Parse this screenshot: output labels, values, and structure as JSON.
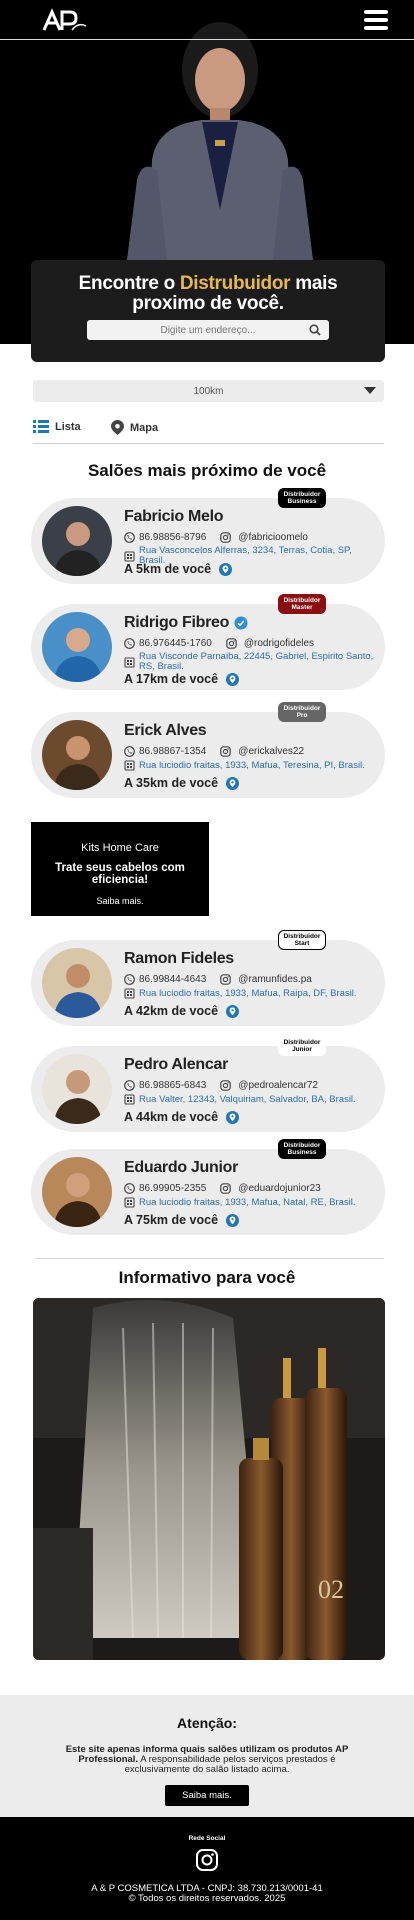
{
  "header": {
    "logo_alt": "AP",
    "menu_icon": "hamburger-icon"
  },
  "hero": {
    "title_pre": "Encontre o ",
    "title_highlight": "Distrubuidor",
    "title_post": " mais",
    "title_line2": "proximo de você.",
    "search_placeholder": "Digite um endereço..."
  },
  "filters": {
    "distance_value": "100km",
    "tab_list": "Lista",
    "tab_map": "Mapa"
  },
  "salons_section": {
    "title": "Salões mais próximo de você",
    "items": [
      {
        "name": "Fabricio Melo",
        "verified": false,
        "phone": "86.98856-8796",
        "instagram": "@fabricioomelo",
        "address": "Rua Vasconcelos Alferras, 3234, Terras, Cotia, SP, Brasil.",
        "distance": "A 5km de você",
        "badge_line1": "Distribuidor",
        "badge_line2": "Business",
        "badge_type": "business"
      },
      {
        "name": "Ridrigo Fibreo",
        "verified": true,
        "phone": "86.976445-1760",
        "instagram": "@rodrigofideles",
        "address": "Rua Visconde Parnaiba, 22445, Gabriel, Espirito Santo, RS, Brasil.",
        "distance": "A 17km de você",
        "badge_line1": "Distribuidor",
        "badge_line2": "Master",
        "badge_type": "master"
      },
      {
        "name": "Erick Alves",
        "verified": false,
        "phone": "86.98867-1354",
        "instagram": "@erickalves22",
        "address": "Rua luciodio fraitas, 1933, Mafua, Teresina, PI, Brasil.",
        "distance": "A 35km de você",
        "badge_line1": "Distribuidor",
        "badge_line2": "Pro",
        "badge_type": "pro"
      },
      {
        "name": "Ramon Fideles",
        "verified": false,
        "phone": "86.99844-4643",
        "instagram": "@ramunfides.pa",
        "address": "Rua luciodio fraitas, 1933, Mafua, Raipa, DF, Brasil.",
        "distance": "A 42km de você",
        "badge_line1": "Distribuidor",
        "badge_line2": "Start",
        "badge_type": "start"
      },
      {
        "name": "Pedro Alencar",
        "verified": false,
        "phone": "86.98865-6843",
        "instagram": "@pedroalencar72",
        "address": "Rua Valter, 12343, Valquiriam, Salvador, BA, Brasil.",
        "distance": "A 44km de você",
        "badge_line1": "Distribuidor",
        "badge_line2": "Junior",
        "badge_type": "junior"
      },
      {
        "name": "Eduardo Junior",
        "verified": false,
        "phone": "86.99905-2355",
        "instagram": "@eduardojunior23",
        "address": "Rua luciodio fraitas, 1933, Mafua, Natal, RE, Brasil.",
        "distance": "A 75km de você",
        "badge_line1": "Distribuidor",
        "badge_line2": "Business",
        "badge_type": "business"
      }
    ]
  },
  "promo": {
    "line1": "Kits Home Care",
    "line2": "Trate seus cabelos com eficiencia!",
    "cta": "Saiba mais."
  },
  "info_section": {
    "title": "Informativo para você"
  },
  "attention": {
    "title": "Atenção:",
    "bold_text": "Este site apenas informa quais salões utilizam os produtos AP Professional.",
    "text": " A responsabilidade pelos serviços prestados é exclusivamente do salão listado acima.",
    "button": "Saiba mais."
  },
  "footer": {
    "social_label": "Rede Social",
    "company": "A & P COSMETICA LTDA - CNPJ: 38.730.213/0001-41",
    "rights": "© Todos os direitos reservados. 2025"
  },
  "colors": {
    "accent": "#e8b84a",
    "link": "#2a6fb2",
    "pin": "#1f77b4",
    "card_bg": "#ececec"
  }
}
